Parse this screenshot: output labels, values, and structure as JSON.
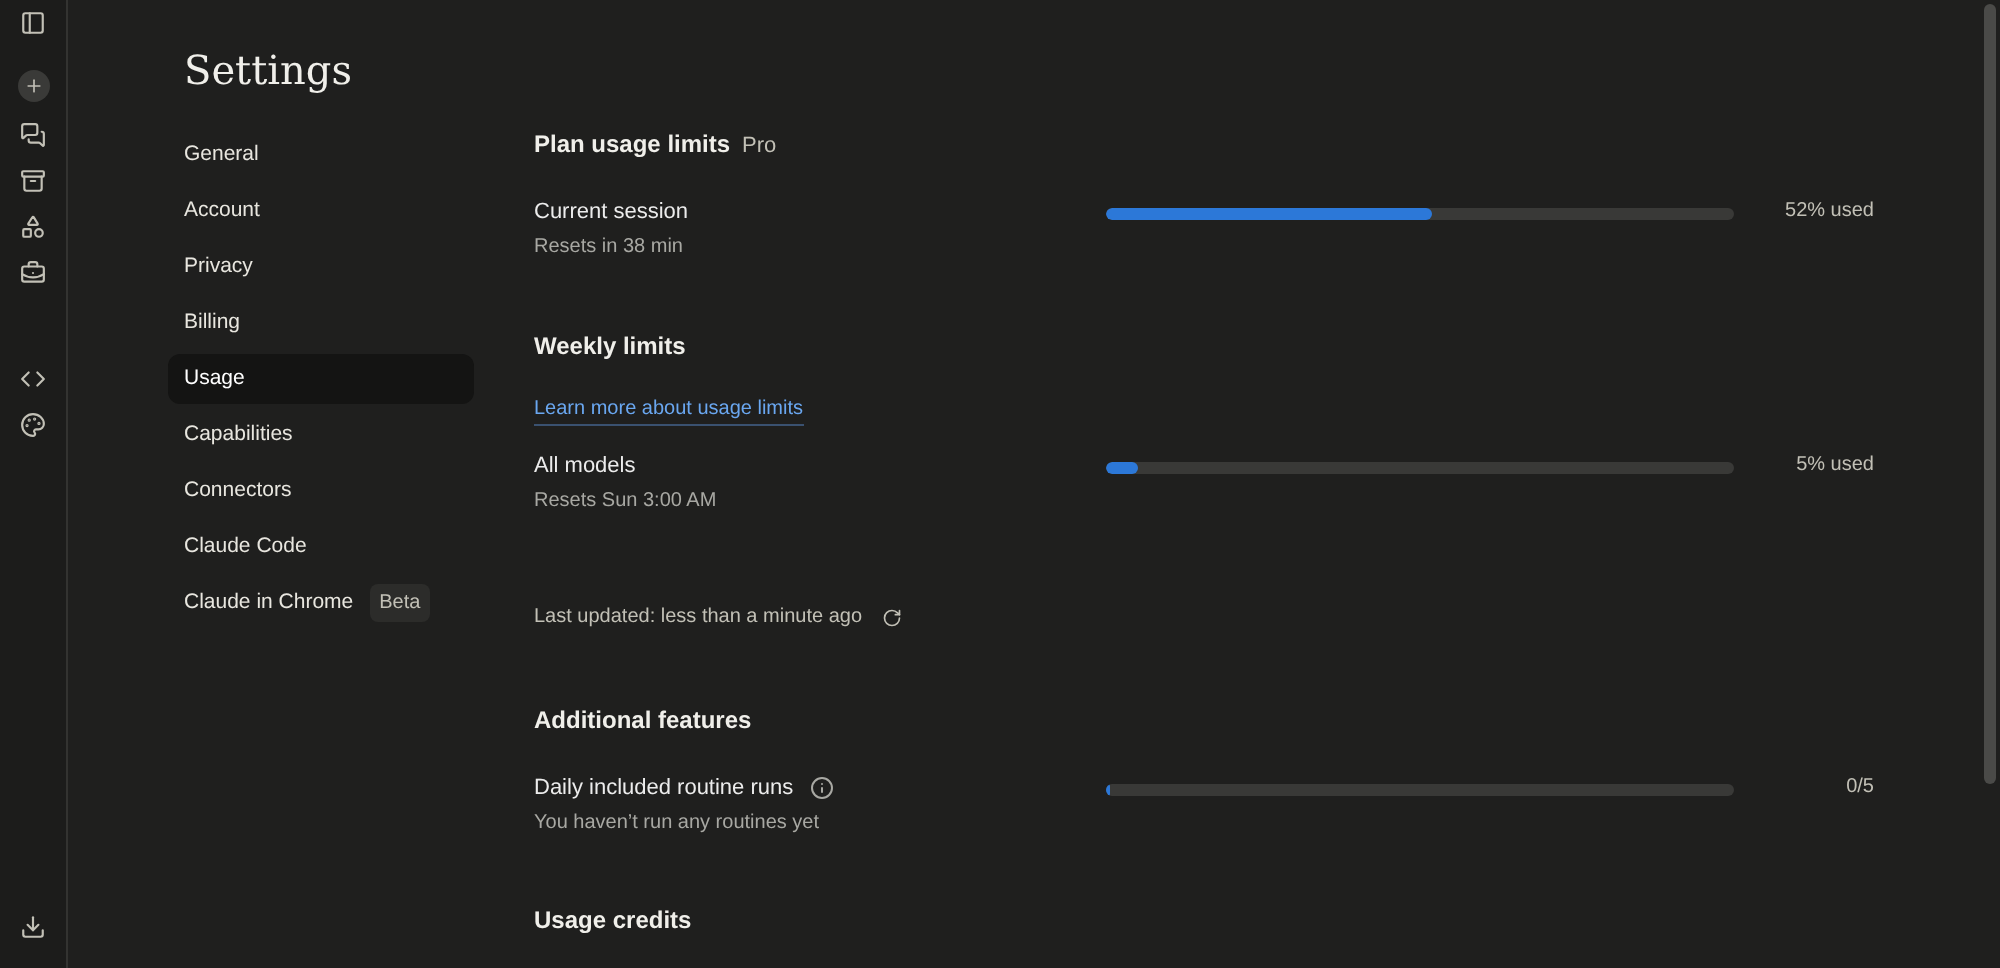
{
  "page": {
    "title": "Settings"
  },
  "nav": [
    {
      "label": "General",
      "selected": false
    },
    {
      "label": "Account",
      "selected": false
    },
    {
      "label": "Privacy",
      "selected": false
    },
    {
      "label": "Billing",
      "selected": false
    },
    {
      "label": "Usage",
      "selected": true
    },
    {
      "label": "Capabilities",
      "selected": false
    },
    {
      "label": "Connectors",
      "selected": false
    },
    {
      "label": "Claude Code",
      "selected": false
    },
    {
      "label": "Claude in Chrome",
      "selected": false,
      "badge": "Beta"
    }
  ],
  "plan_usage": {
    "title": "Plan usage limits",
    "plan": "Pro",
    "current_session": {
      "name": "Current session",
      "detail": "Resets in 38 min",
      "level": 0.52,
      "reading": "52% used"
    }
  },
  "weekly_limits": {
    "title": "Weekly limits",
    "link": "Learn more about usage limits",
    "all_models": {
      "name": "All models",
      "detail": "Resets Sun 3:00 AM",
      "level": 0.05,
      "reading": "5% used"
    },
    "last_updated": "Last updated: less than a minute ago"
  },
  "additional_features": {
    "title": "Additional features",
    "routine_runs": {
      "name": "Daily included routine runs",
      "detail": "You haven’t run any routines yet",
      "level": 0.0,
      "reading": "0/5"
    }
  },
  "usage_credits": {
    "title": "Usage credits"
  }
}
